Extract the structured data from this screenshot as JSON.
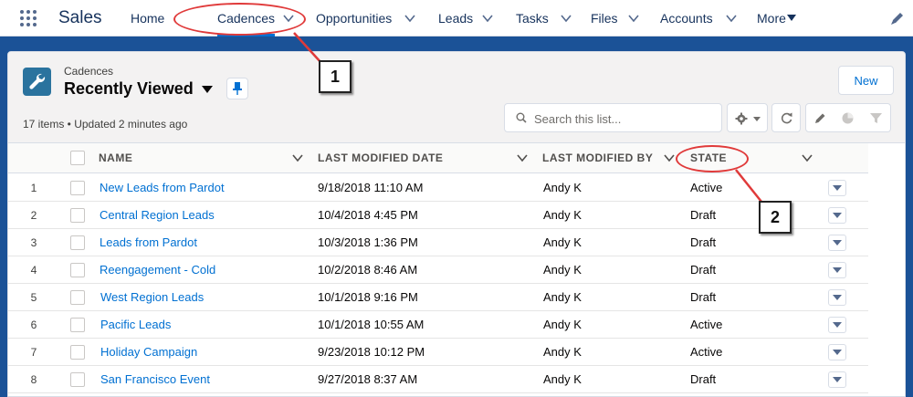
{
  "app": {
    "name": "Sales"
  },
  "nav": {
    "items": [
      {
        "label": "Home"
      },
      {
        "label": "Cadences"
      },
      {
        "label": "Opportunities"
      },
      {
        "label": "Leads"
      },
      {
        "label": "Tasks"
      },
      {
        "label": "Files"
      },
      {
        "label": "Accounts"
      },
      {
        "label": "More"
      }
    ],
    "active": "Cadences"
  },
  "list_view": {
    "object_label": "Cadences",
    "title": "Recently Viewed",
    "new_button_label": "New",
    "status": "17 items • Updated 2 minutes ago",
    "search_placeholder": "Search this list..."
  },
  "table": {
    "columns": [
      "NAME",
      "LAST MODIFIED DATE",
      "LAST MODIFIED BY",
      "STATE"
    ],
    "rows": [
      {
        "num": "1",
        "name": "New Leads from Pardot",
        "modified_date": "9/18/2018 11:10 AM",
        "modified_by": "Andy K",
        "state": "Active"
      },
      {
        "num": "2",
        "name": "Central Region Leads",
        "modified_date": "10/4/2018 4:45 PM",
        "modified_by": "Andy K",
        "state": "Draft"
      },
      {
        "num": "3",
        "name": "Leads from Pardot",
        "modified_date": "10/3/2018 1:36 PM",
        "modified_by": "Andy K",
        "state": "Draft"
      },
      {
        "num": "4",
        "name": "Reengagement - Cold",
        "modified_date": "10/2/2018 8:46 AM",
        "modified_by": "Andy K",
        "state": "Draft"
      },
      {
        "num": "5",
        "name": "West Region Leads",
        "modified_date": "10/1/2018 9:16 PM",
        "modified_by": "Andy K",
        "state": "Draft"
      },
      {
        "num": "6",
        "name": "Pacific Leads",
        "modified_date": "10/1/2018 10:55 AM",
        "modified_by": "Andy K",
        "state": "Active"
      },
      {
        "num": "7",
        "name": "Holiday Campaign",
        "modified_date": "9/23/2018 10:12 PM",
        "modified_by": "Andy K",
        "state": "Active"
      },
      {
        "num": "8",
        "name": "San Francisco Event",
        "modified_date": "9/27/2018 8:37 AM",
        "modified_by": "Andy K",
        "state": "Draft"
      }
    ]
  },
  "callouts": [
    {
      "label": "1"
    },
    {
      "label": "2"
    }
  ],
  "colors": {
    "brand_blue": "#1b5297",
    "link": "#0070d2",
    "object_icon": "#2a739e",
    "callout_red": "#e03a3a"
  },
  "icons": [
    "app-launcher-icon",
    "chevron-down-icon",
    "pencil-icon",
    "wrench-icon",
    "pin-icon",
    "search-icon",
    "gear-icon",
    "refresh-icon",
    "edit-icon",
    "chart-icon",
    "filter-icon"
  ]
}
